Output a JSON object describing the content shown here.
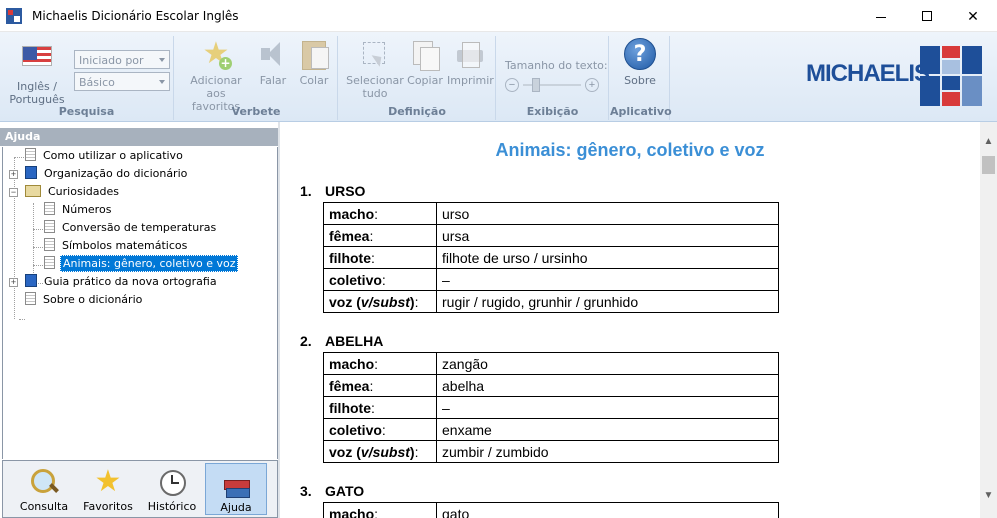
{
  "window": {
    "title": "Michaelis Dicionário Escolar Inglês"
  },
  "ribbon": {
    "pesquisa": {
      "group_label": "Pesquisa",
      "language_button": "Inglês / Português",
      "level_combo": "Iniciado por",
      "mode_combo": "Básico"
    },
    "verbete": {
      "group_label": "Verbete",
      "add_favorites": "Adicionar aos favoritos",
      "speak": "Falar",
      "paste": "Colar"
    },
    "definicao": {
      "group_label": "Definição",
      "select_all": "Selecionar tudo",
      "copy": "Copiar",
      "print": "Imprimir"
    },
    "exibicao": {
      "group_label": "Exibição",
      "text_size_label": "Tamanho do texto:",
      "minus": "−",
      "plus": "+"
    },
    "aplicativo": {
      "group_label": "Aplicativo",
      "about": "Sobre",
      "help_glyph": "?"
    },
    "logo_text": "MICHAELIS"
  },
  "left_panel": {
    "header": "Ajuda",
    "tree": [
      {
        "label": "Como utilizar o aplicativo"
      },
      {
        "label": "Organização do dicionário"
      },
      {
        "label": "Curiosidades"
      },
      {
        "label": "Números"
      },
      {
        "label": "Conversão de temperaturas"
      },
      {
        "label": "Símbolos matemáticos"
      },
      {
        "label": "Animais: gênero, coletivo e voz"
      },
      {
        "label": "Guia prático da nova ortografia"
      },
      {
        "label": "Sobre o dicionário"
      }
    ],
    "nav": [
      {
        "label": "Consulta"
      },
      {
        "label": "Favoritos"
      },
      {
        "label": "Histórico"
      },
      {
        "label": "Ajuda"
      }
    ]
  },
  "content": {
    "title": "Animais: gênero, coletivo e voz",
    "entries": [
      {
        "num": "1.",
        "name": "URSO",
        "rows": [
          {
            "key": "macho",
            "value": "urso"
          },
          {
            "key": "fêmea",
            "value": "ursa"
          },
          {
            "key": "filhote",
            "value": "filhote de urso / ursinho"
          },
          {
            "key": "coletivo",
            "value": "–"
          },
          {
            "key": "voz (v/subst)",
            "value": "rugir / rugido, grunhir / grunhido"
          }
        ]
      },
      {
        "num": "2.",
        "name": "ABELHA",
        "rows": [
          {
            "key": "macho",
            "value": "zangão"
          },
          {
            "key": "fêmea",
            "value": "abelha"
          },
          {
            "key": "filhote",
            "value": "–"
          },
          {
            "key": "coletivo",
            "value": "enxame"
          },
          {
            "key": "voz (v/subst)",
            "value": "zumbir / zumbido"
          }
        ]
      },
      {
        "num": "3.",
        "name": "GATO",
        "rows": [
          {
            "key": "macho",
            "value": "gato"
          }
        ]
      }
    ]
  },
  "colors": {
    "title_blue": "#3b8fd6",
    "selection": "#0078d7",
    "logo_blue": "#1e4f99"
  }
}
